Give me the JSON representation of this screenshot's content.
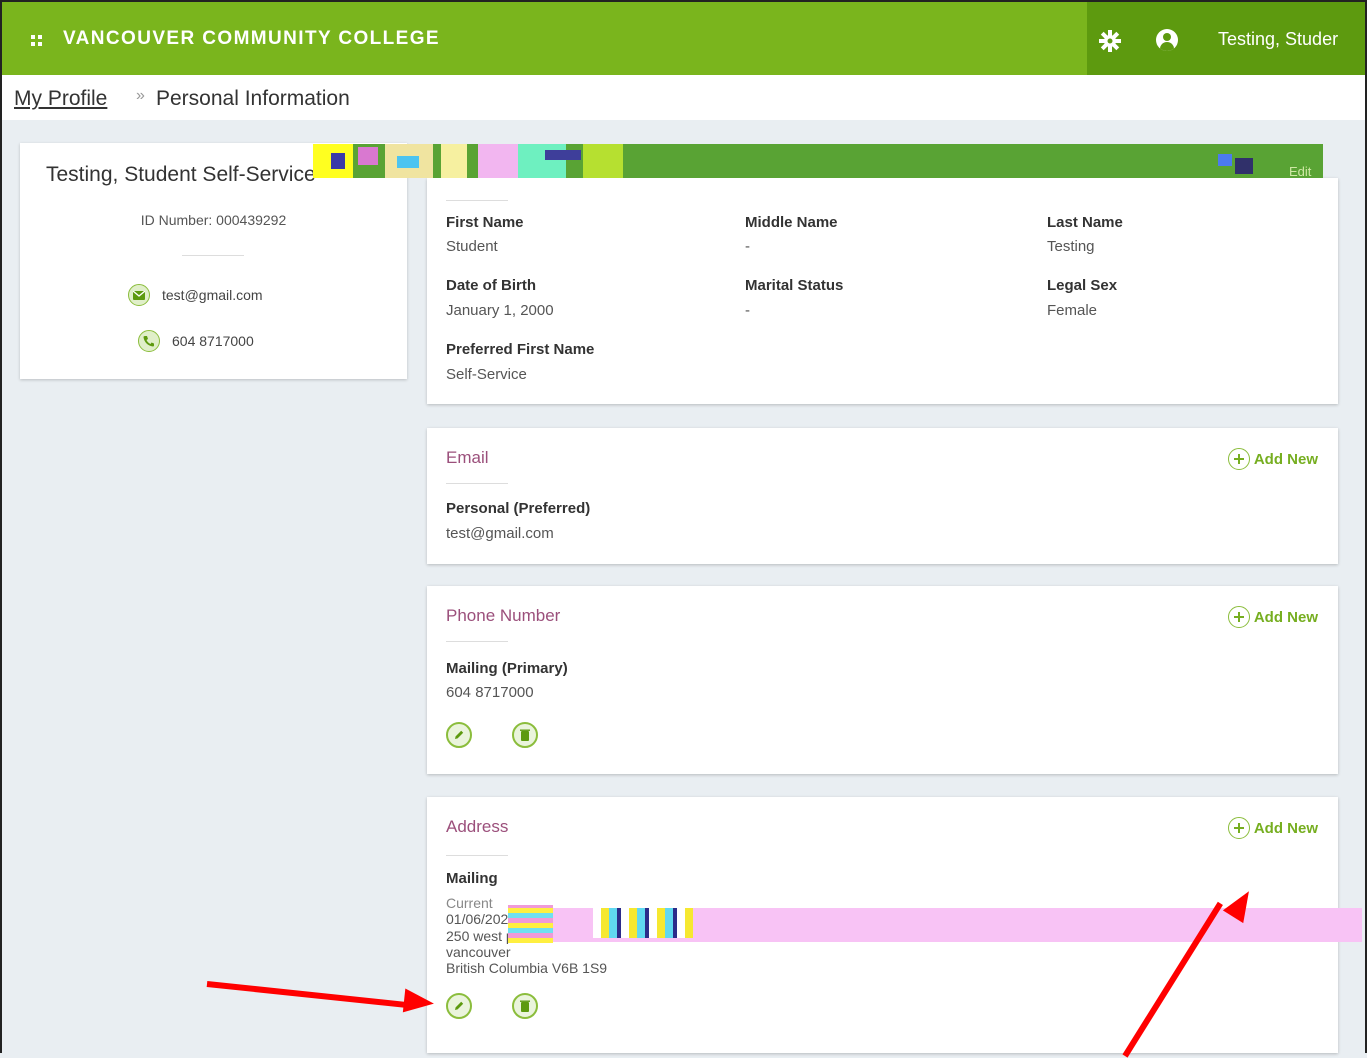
{
  "header": {
    "brand": "VANCOUVER COMMUNITY COLLEGE",
    "user_name": "Testing, Studer",
    "accent_color": "#7ab51d",
    "icons": [
      "app-grid-icon",
      "gear-icon",
      "user-avatar-icon"
    ]
  },
  "breadcrumb": {
    "parent": "My Profile",
    "separator": "»",
    "current": "Personal Information"
  },
  "profile": {
    "name": "Testing, Student Self-Service",
    "id_line": "ID Number: 000439292",
    "email": "test@gmail.com",
    "phone": "604 8717000"
  },
  "personal": {
    "edit_label": "Edit",
    "fields": [
      {
        "label": "First Name",
        "value": "Student"
      },
      {
        "label": "Middle Name",
        "value": "-"
      },
      {
        "label": "Last Name",
        "value": "Testing"
      },
      {
        "label": "Date of Birth",
        "value": "January 1, 2000"
      },
      {
        "label": "Marital Status",
        "value": "-"
      },
      {
        "label": "Legal Sex",
        "value": "Female"
      },
      {
        "label": "Preferred First Name",
        "value": "Self-Service"
      }
    ]
  },
  "email_section": {
    "title": "Email",
    "add_label": "Add New",
    "entry_label": "Personal (Preferred)",
    "entry_value": "test@gmail.com"
  },
  "phone_section": {
    "title": "Phone Number",
    "add_label": "Add New",
    "entry_label": "Mailing (Primary)",
    "entry_value": "604 8717000"
  },
  "address_section": {
    "title": "Address",
    "add_label": "Add New",
    "entry_label": "Mailing",
    "status": "Current",
    "date": "01/06/202",
    "street": "250 west pender street",
    "city": "vancouver",
    "region": "British Columbia V6B 1S9"
  }
}
